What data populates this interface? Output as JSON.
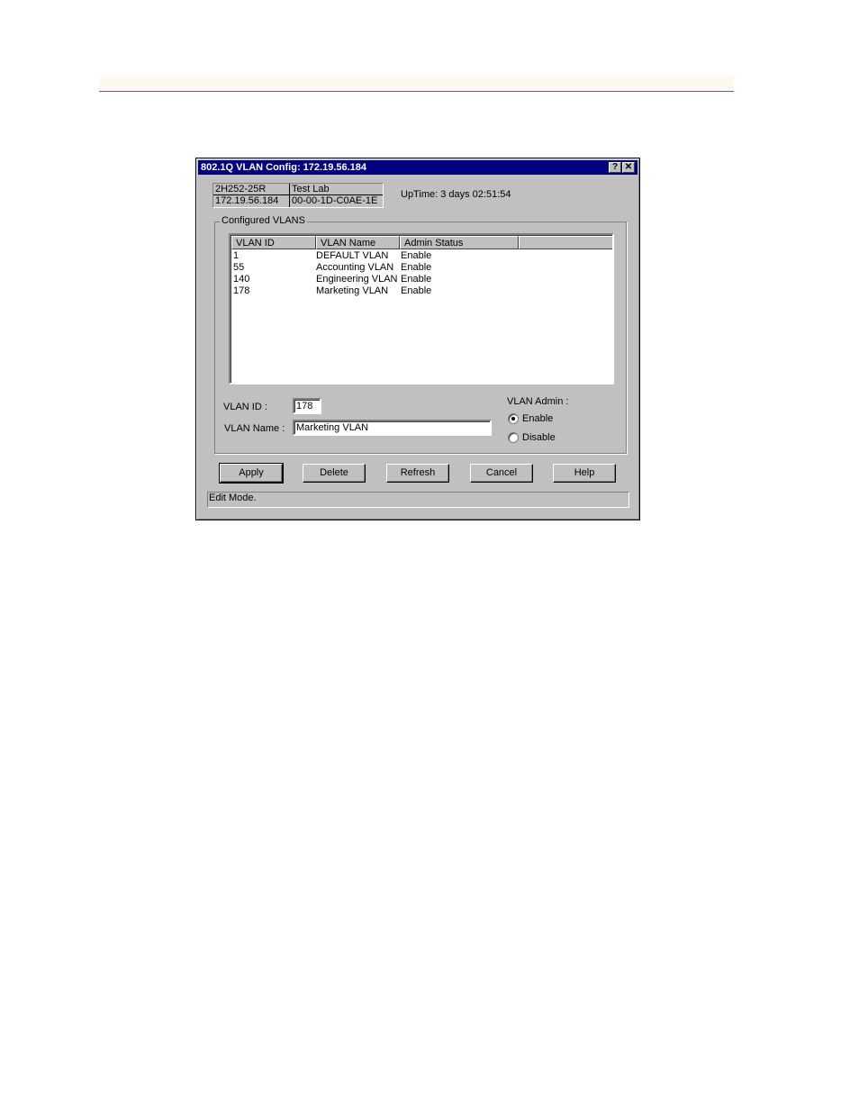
{
  "dialog": {
    "title": "802.1Q VLAN Config: 172.19.56.184",
    "help_glyph": "?",
    "close_glyph": "✕"
  },
  "device_info": {
    "name": "2H252-25R",
    "location": "Test Lab",
    "ip": "172.19.56.184",
    "mac": "00-00-1D-C0AE-1E"
  },
  "uptime": "UpTime: 3 days 02:51:54",
  "vlan_group": {
    "label": "Configured VLANS",
    "columns": [
      "VLAN ID",
      "VLAN Name",
      "Admin Status"
    ],
    "rows": [
      {
        "id": "1",
        "name": "DEFAULT VLAN",
        "status": "Enable"
      },
      {
        "id": "55",
        "name": "Accounting VLAN",
        "status": "Enable"
      },
      {
        "id": "140",
        "name": "Engineering VLAN",
        "status": "Enable"
      },
      {
        "id": "178",
        "name": "Marketing VLAN",
        "status": "Enable"
      }
    ]
  },
  "form": {
    "vlan_id_label": "VLAN ID :",
    "vlan_id_value": "178",
    "vlan_name_label": "VLAN Name :",
    "vlan_name_value": "Marketing VLAN",
    "admin_label": "VLAN Admin :",
    "enable_label": "Enable",
    "disable_label": "Disable",
    "admin_selected": "Enable"
  },
  "buttons": {
    "apply": "Apply",
    "delete": "Delete",
    "refresh": "Refresh",
    "cancel": "Cancel",
    "help": "Help"
  },
  "status": "Edit Mode."
}
